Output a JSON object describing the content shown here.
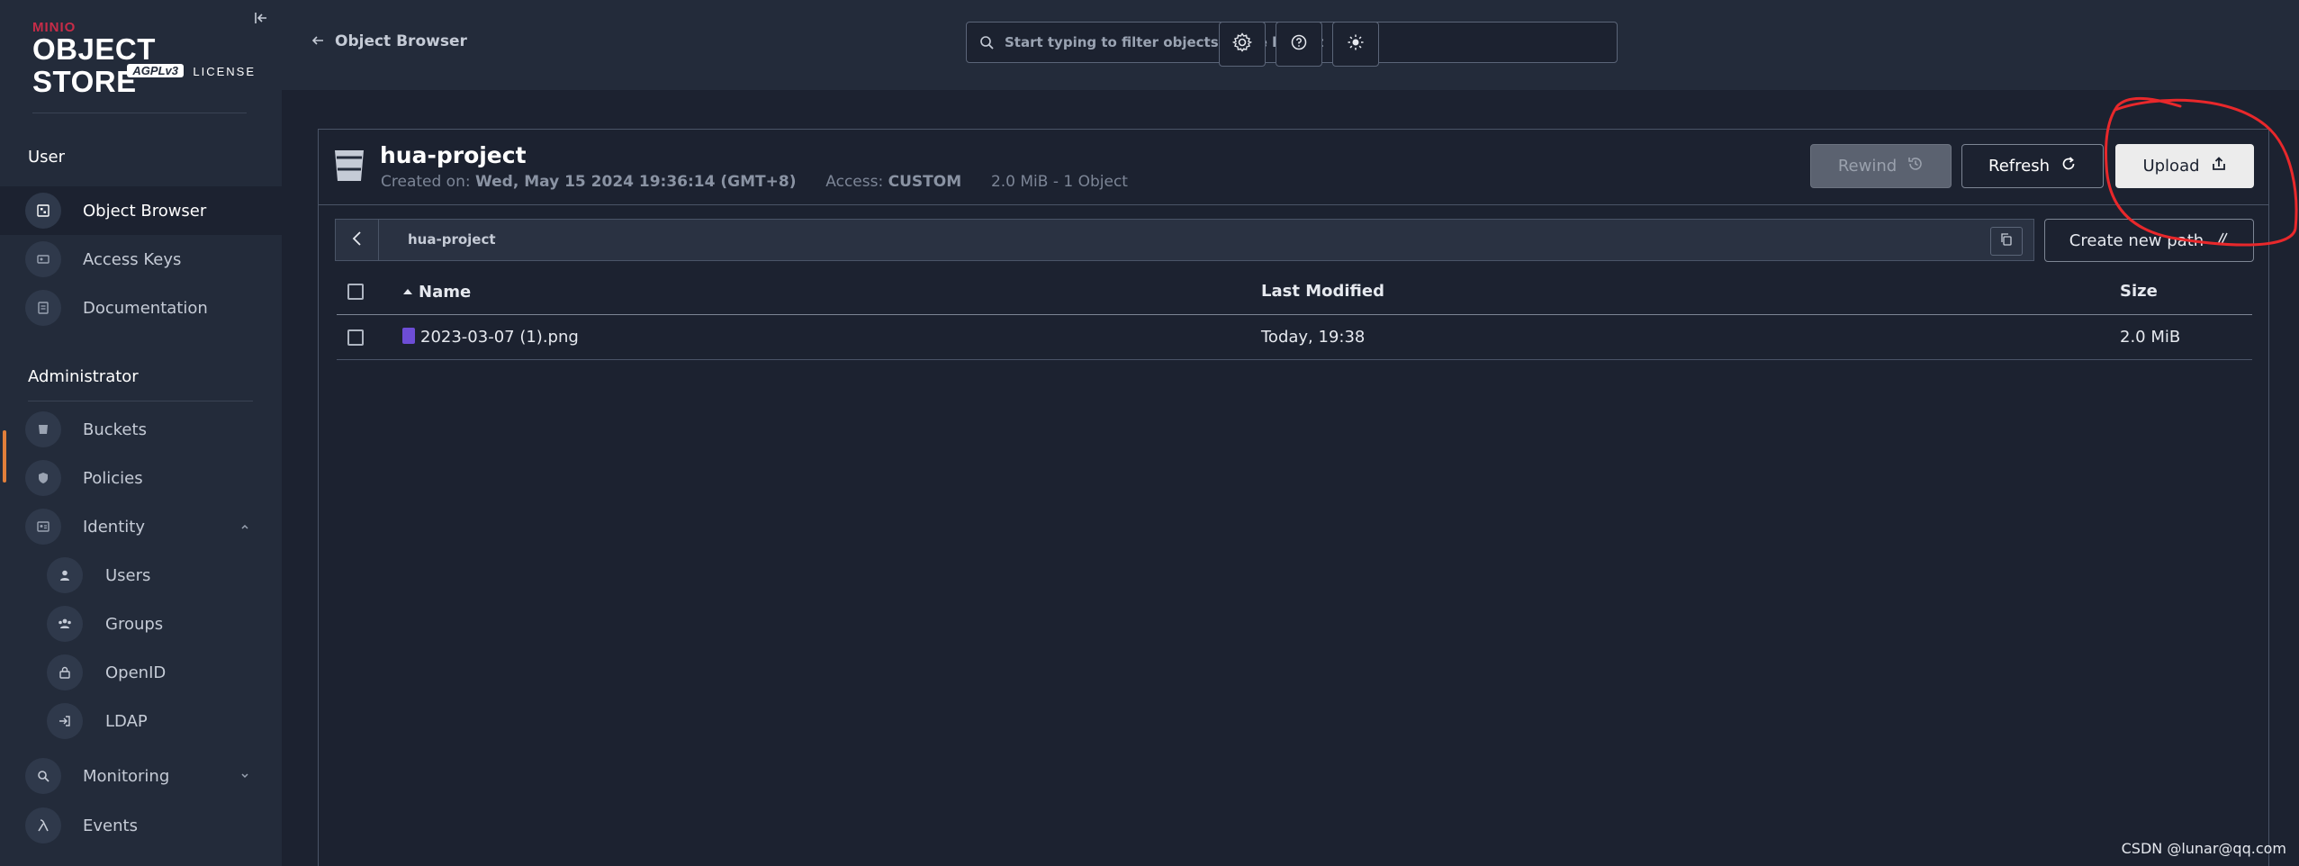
{
  "app": {
    "logo_small": "MINIO",
    "logo_main": "OBJECT STORE",
    "logo_agpl": "AGPLv3",
    "logo_license": "LICENSE"
  },
  "sidebar": {
    "section_user": "User",
    "user_items": [
      {
        "label": "Object Browser",
        "icon": "object-browser-icon"
      },
      {
        "label": "Access Keys",
        "icon": "key-icon"
      },
      {
        "label": "Documentation",
        "icon": "doc-icon"
      }
    ],
    "section_admin": "Administrator",
    "admin_items": [
      {
        "label": "Buckets",
        "icon": "bucket-icon"
      },
      {
        "label": "Policies",
        "icon": "shield-icon"
      },
      {
        "label": "Identity",
        "icon": "id-card-icon"
      },
      {
        "label": "Users",
        "icon": "user-icon"
      },
      {
        "label": "Groups",
        "icon": "group-icon"
      },
      {
        "label": "OpenID",
        "icon": "lock-icon"
      },
      {
        "label": "LDAP",
        "icon": "login-icon"
      },
      {
        "label": "Monitoring",
        "icon": "search-icon"
      },
      {
        "label": "Events",
        "icon": "lambda-icon"
      }
    ]
  },
  "header": {
    "back_label": "Object Browser",
    "search_placeholder": "Start typing to filter objects in the bucket"
  },
  "bucket": {
    "name": "hua-project",
    "created_label": "Created on:",
    "created_value": "Wed, May 15 2024 19:36:14 (GMT+8)",
    "access_label": "Access:",
    "access_value": "CUSTOM",
    "summary": "2.0 MiB - 1 Object",
    "rewind_label": "Rewind",
    "refresh_label": "Refresh",
    "upload_label": "Upload",
    "path": "hua-project",
    "new_path_label": "Create new path"
  },
  "table": {
    "headers": [
      "Name",
      "Last Modified",
      "Size"
    ],
    "rows": [
      {
        "name": "2023-03-07 (1).png",
        "modified": "Today, 19:38",
        "size": "2.0 MiB"
      }
    ]
  },
  "watermark": "CSDN @lunar@qq.com",
  "colors": {
    "sidebar_bg": "#232b3a",
    "main_bg": "#1c2230",
    "brand_red": "#c72c48",
    "annotation_red": "#e8282b"
  }
}
